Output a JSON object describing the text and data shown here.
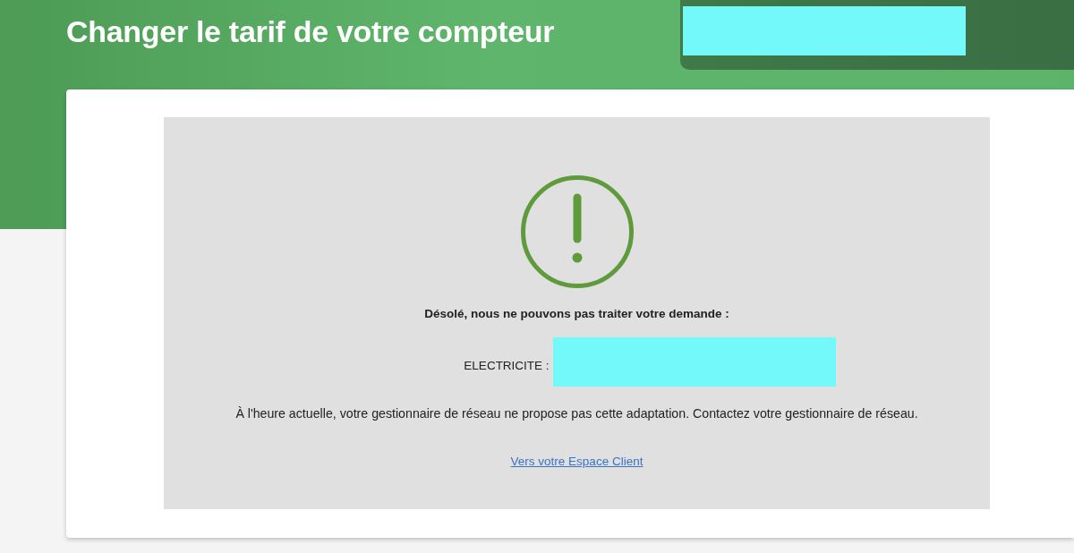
{
  "page": {
    "title": "Changer le tarif de votre compteur"
  },
  "account": {
    "redacted": true
  },
  "notice": {
    "kind": "warning",
    "heading": "Désolé, nous ne pouvons pas traiter votre demande :",
    "meter": {
      "label": "ELECTRICITE :",
      "redacted": true
    },
    "message": "À l'heure actuelle, votre gestionnaire de réseau ne propose pas cette adaptation. Contactez votre gestionnaire de réseau.",
    "link": "Vers votre Espace Client"
  }
}
